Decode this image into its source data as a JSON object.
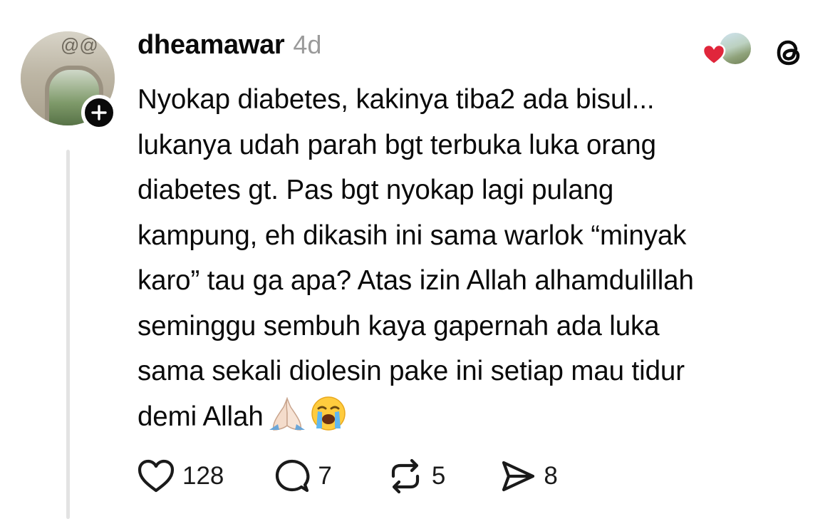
{
  "post": {
    "username": "dheamawar",
    "time": "4d",
    "text_lines": [
      "Nyokap diabetes, kakinya tiba2 ada bisul...",
      "lukanya udah parah bgt terbuka luka orang",
      "diabetes gt. Pas bgt nyokap lagi pulang",
      "kampung, eh dikasih ini sama warlok “minyak",
      "karo” tau ga apa? Atas izin Allah alhamdulillah",
      "seminggu sembuh kaya gapernah ada luka",
      "sama sekali diolesin pake ini setiap mau tidur",
      "demi Allah"
    ],
    "emojis": [
      "folded-hands-emoji",
      "loudly-crying-face-emoji"
    ]
  },
  "actions": {
    "likes": "128",
    "replies": "7",
    "reposts": "5",
    "shares": "8"
  },
  "icons": {
    "follow": "plus-icon",
    "like": "heart-outline-icon",
    "reply": "speech-bubble-icon",
    "repost": "repost-icon",
    "share": "send-icon",
    "app": "threads-logo-icon",
    "liked_badge": "red-heart-icon"
  },
  "colors": {
    "text": "#0a0a0a",
    "muted": "#9a9a9a",
    "heart": "#e0263b",
    "thread_line": "#e3e3e3"
  }
}
